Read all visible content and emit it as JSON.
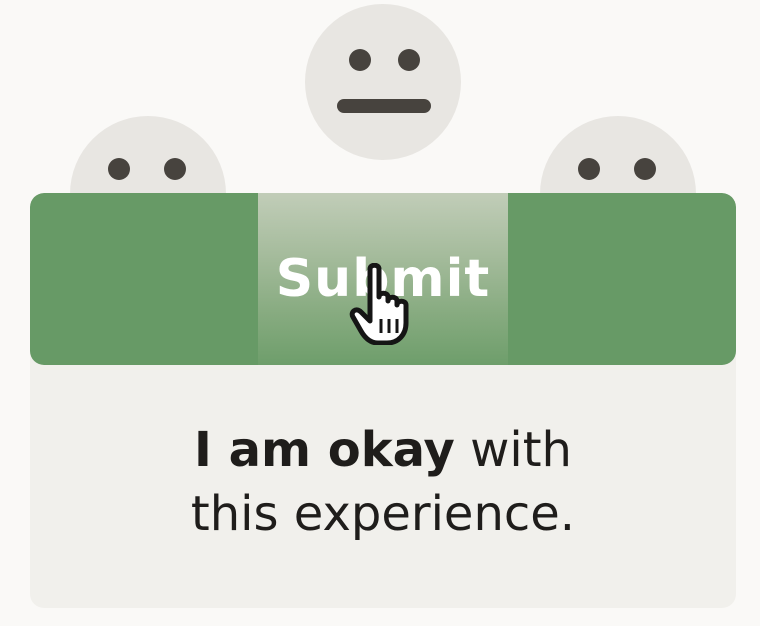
{
  "faces": [
    {
      "name": "neutral-face-center",
      "expression": "neutral"
    },
    {
      "name": "face-left",
      "expression": "peeking"
    },
    {
      "name": "face-right",
      "expression": "peeking"
    }
  ],
  "banner": {
    "submit_label": "Submit",
    "color": "#679a66",
    "highlight_color": "#a6bc9d"
  },
  "message": {
    "bold": "I am okay",
    "rest_line1": " with",
    "line2": "this experience."
  },
  "cursor": {
    "icon": "hand-pointer-icon"
  }
}
